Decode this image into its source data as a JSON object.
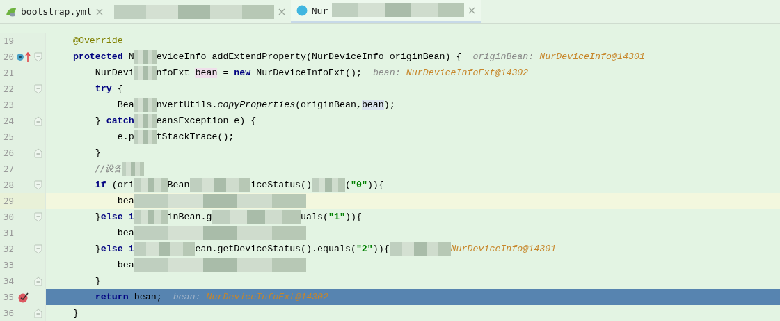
{
  "tabs": [
    {
      "kind": "yaml",
      "label": "bootstrap.yml",
      "redacted": false,
      "selected": false
    },
    {
      "kind": "blank",
      "redacted": true,
      "selected": false
    },
    {
      "kind": "class",
      "label": "Nur",
      "redacted": true,
      "selected": true
    }
  ],
  "lines": [
    {
      "number": "19",
      "kind": "code",
      "tokens": [
        {
          "kind": "annotation",
          "text": "    @Override"
        }
      ]
    },
    {
      "number": "20",
      "kind": "code",
      "gutter_icons": [
        {
          "kind": "override"
        }
      ],
      "fold": {
        "kind": "start"
      },
      "tokens": [
        {
          "kind": "keyword",
          "text": "    protected"
        },
        {
          "kind": "plain",
          "text": " N"
        },
        {
          "kind": "redacted-s"
        },
        {
          "kind": "plain",
          "text": "eviceInfo addExtendProperty(NurDeviceInfo originBean) {"
        },
        {
          "kind": "hint-label",
          "text": "originBean: "
        },
        {
          "kind": "hint-value",
          "text": "NurDeviceInfo@14301"
        }
      ]
    },
    {
      "number": "21",
      "kind": "code",
      "tokens": [
        {
          "kind": "plain",
          "text": "        NurDevi"
        },
        {
          "kind": "redacted-xs"
        },
        {
          "kind": "plain",
          "text": "nfoExt "
        },
        {
          "kind": "write-usage",
          "text": "bean"
        },
        {
          "kind": "plain",
          "text": " = "
        },
        {
          "kind": "keyword",
          "text": "new"
        },
        {
          "kind": "plain",
          "text": " NurDeviceInfoExt();"
        },
        {
          "kind": "hint-label",
          "text": "bean: "
        },
        {
          "kind": "hint-value",
          "text": "NurDeviceInfoExt@14302"
        }
      ]
    },
    {
      "number": "22",
      "kind": "code",
      "fold": {
        "kind": "start"
      },
      "tokens": [
        {
          "kind": "keyword",
          "text": "        try"
        },
        {
          "kind": "plain",
          "text": " {"
        }
      ]
    },
    {
      "number": "23",
      "kind": "code",
      "tokens": [
        {
          "kind": "plain",
          "text": "            Bea"
        },
        {
          "kind": "redacted-xs"
        },
        {
          "kind": "plain",
          "text": "nvertUtils."
        },
        {
          "kind": "method-static",
          "text": "copyProperties"
        },
        {
          "kind": "plain",
          "text": "(originBean,"
        },
        {
          "kind": "read-usage",
          "text": "bean"
        },
        {
          "kind": "plain",
          "text": ");"
        }
      ]
    },
    {
      "number": "24",
      "kind": "code",
      "fold": {
        "kind": "end"
      },
      "tokens": [
        {
          "kind": "plain",
          "text": "        } "
        },
        {
          "kind": "keyword",
          "text": "catch"
        },
        {
          "kind": "redacted-s"
        },
        {
          "kind": "plain",
          "text": "eansException e) {"
        }
      ]
    },
    {
      "number": "25",
      "kind": "code",
      "tokens": [
        {
          "kind": "plain",
          "text": "            e.p"
        },
        {
          "kind": "redacted-xs"
        },
        {
          "kind": "plain",
          "text": "tStackTrace();"
        }
      ]
    },
    {
      "number": "26",
      "kind": "code",
      "fold": {
        "kind": "end"
      },
      "tokens": [
        {
          "kind": "plain",
          "text": "        }"
        }
      ]
    },
    {
      "number": "27",
      "kind": "code",
      "tokens": [
        {
          "kind": "comment",
          "text": "        //设备"
        },
        {
          "kind": "redacted-xs"
        }
      ]
    },
    {
      "number": "28",
      "kind": "code",
      "fold": {
        "kind": "start"
      },
      "tokens": [
        {
          "kind": "keyword",
          "text": "        if"
        },
        {
          "kind": "plain",
          "text": " (ori"
        },
        {
          "kind": "redacted-m"
        },
        {
          "kind": "plain",
          "text": "Bean"
        },
        {
          "kind": "redacted-l"
        },
        {
          "kind": "plain",
          "text": "iceStatus()"
        },
        {
          "kind": "redacted-m"
        },
        {
          "kind": "plain",
          "text": "("
        },
        {
          "kind": "string",
          "text": "\"0\""
        },
        {
          "kind": "plain",
          "text": ")){"
        }
      ]
    },
    {
      "number": "29",
      "kind": "caret",
      "tokens": [
        {
          "kind": "plain",
          "text": "            bea"
        },
        {
          "kind": "redacted-xxl"
        }
      ]
    },
    {
      "number": "30",
      "kind": "code",
      "fold": {
        "kind": "start"
      },
      "tokens": [
        {
          "kind": "plain",
          "text": "        }"
        },
        {
          "kind": "keyword",
          "text": "else i"
        },
        {
          "kind": "redacted-m"
        },
        {
          "kind": "plain",
          "text": "inBean.g"
        },
        {
          "kind": "redacted-xl"
        },
        {
          "kind": "plain",
          "text": "uals("
        },
        {
          "kind": "string",
          "text": "\"1\""
        },
        {
          "kind": "plain",
          "text": ")){"
        }
      ]
    },
    {
      "number": "31",
      "kind": "code",
      "tokens": [
        {
          "kind": "plain",
          "text": "            bea"
        },
        {
          "kind": "redacted-xxl"
        }
      ]
    },
    {
      "number": "32",
      "kind": "code",
      "fold": {
        "kind": "start"
      },
      "tokens": [
        {
          "kind": "plain",
          "text": "        }"
        },
        {
          "kind": "keyword",
          "text": "else i"
        },
        {
          "kind": "redacted-l"
        },
        {
          "kind": "plain",
          "text": "ean.getDeviceStatus().equals("
        },
        {
          "kind": "string",
          "text": "\"2\""
        },
        {
          "kind": "plain",
          "text": ")){"
        },
        {
          "kind": "redacted-l"
        },
        {
          "kind": "hint-value",
          "text": "NurDeviceInfo@14301"
        }
      ]
    },
    {
      "number": "33",
      "kind": "code",
      "tokens": [
        {
          "kind": "plain",
          "text": "            bea"
        },
        {
          "kind": "redacted-xxl"
        }
      ]
    },
    {
      "number": "34",
      "kind": "code",
      "fold": {
        "kind": "end"
      },
      "tokens": [
        {
          "kind": "plain",
          "text": "        }"
        }
      ]
    },
    {
      "number": "35",
      "kind": "execution",
      "gutter_icons": [
        {
          "kind": "breakpoint"
        }
      ],
      "tokens": [
        {
          "kind": "keyword",
          "text": "        return"
        },
        {
          "kind": "plain",
          "text": " bean;"
        },
        {
          "kind": "hint-label",
          "text": "bean: "
        },
        {
          "kind": "hint-value",
          "text": "NurDeviceInfoExt@14302"
        }
      ]
    },
    {
      "number": "36",
      "kind": "code",
      "fold": {
        "kind": "end"
      },
      "tokens": [
        {
          "kind": "plain",
          "text": "    }"
        }
      ]
    }
  ]
}
